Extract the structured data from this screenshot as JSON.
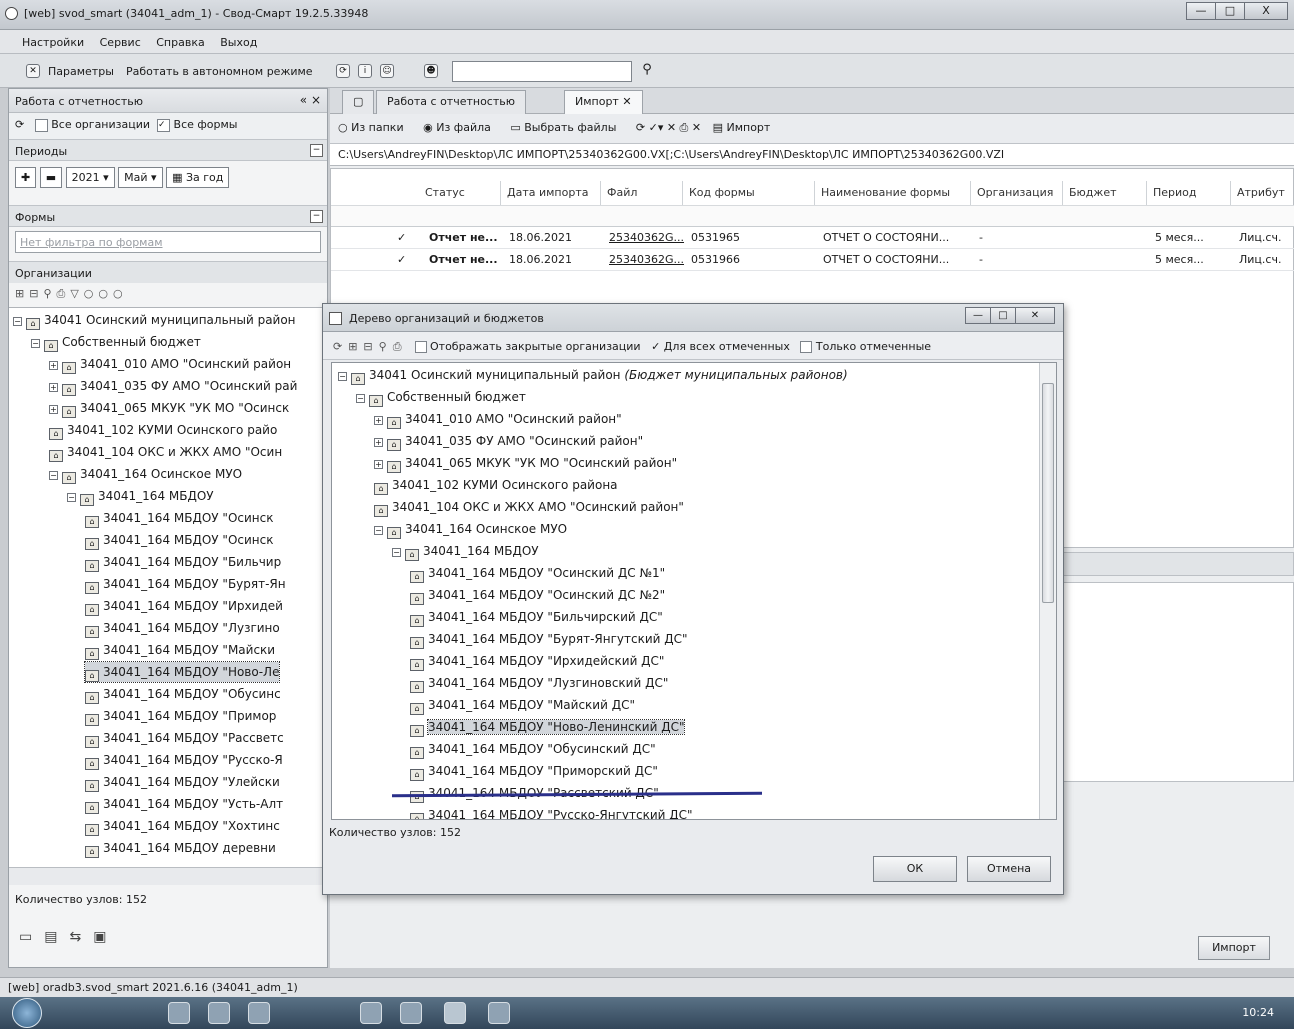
{
  "window": {
    "title": "[web] svod_smart (34041_adm_1) - Свод-Смарт 19.2.5.33948",
    "minimize": "—",
    "maximize": "□",
    "close": "X"
  },
  "menu": [
    "Настройки",
    "Сервис",
    "Справка",
    "Выход"
  ],
  "toolbar": {
    "params_label": "Параметры",
    "offline_label": "Работать в автономном режиме",
    "search_value": ""
  },
  "left": {
    "title": "Работа с отчетностью",
    "close": "« ×",
    "all_orgs": "Все организации",
    "all_forms": "Все формы",
    "periods": "Периоды",
    "year": "2021",
    "month": "Май",
    "for_year": "За год",
    "forms": "Формы",
    "forms_filter": "Нет фильтра по формам",
    "orgs": "Организации",
    "tree": [
      "34041 Осинский муниципальный район",
      "Собственный бюджет",
      "34041_010 АМО \"Осинский район",
      "34041_035 ФУ АМО \"Осинский рай",
      "34041_065 МКУК \"УК МО \"Осинск",
      "34041_102 КУМИ Осинского райо",
      "34041_104 ОКС и ЖКХ АМО \"Осин",
      "34041_164 Осинское МУО",
      "34041_164 МБДОУ",
      "34041_164 МБДОУ \"Осинск",
      "34041_164 МБДОУ \"Осинск",
      "34041_164 МБДОУ \"Бильчир",
      "34041_164 МБДОУ \"Бурят-Ян",
      "34041_164 МБДОУ \"Ирхидей",
      "34041_164 МБДОУ \"Лузгино",
      "34041_164 МБДОУ \"Майски",
      "34041_164 МБДОУ \"Ново-Ле",
      "34041_164 МБДОУ \"Обусинс",
      "34041_164 МБДОУ \"Примор",
      "34041_164 МБДОУ \"Рассветс",
      "34041_164 МБДОУ \"Русско-Я",
      "34041_164 МБДОУ \"Улейски",
      "34041_164 МБДОУ \"Усть-Алт",
      "34041_164 МБДОУ \"Хохтинс",
      "34041_164 МБДОУ деревни"
    ],
    "count": "Количество узлов: 152"
  },
  "tabs": [
    "Работа с отчетностью",
    "Импорт"
  ],
  "subtoolbar": {
    "from_folder": "Из папки",
    "from_file": "Из файла",
    "choose_files": "Выбрать файлы",
    "import": "Импорт"
  },
  "path": "C:\\Users\\AndreyFIN\\Desktop\\ЛС  ИМПОРТ\\25340362G00.VX[;C:\\Users\\AndreyFIN\\Desktop\\ЛС  ИМПОРТ\\25340362G00.VZI",
  "grid": {
    "headers": [
      "Статус",
      "Дата импорта",
      "Файл",
      "Код формы",
      "Наименование формы",
      "Организация",
      "Бюджет",
      "Период",
      "Атрибут"
    ],
    "rows": [
      [
        "✓",
        "Отчет не...",
        "18.06.2021",
        "25340362G...",
        "0531965",
        "ОТЧЕТ О СОСТОЯНИ...",
        "-",
        "",
        "5 меся...",
        "Лиц.сч."
      ],
      [
        "✓",
        "Отчет не...",
        "18.06.2021",
        "25340362G...",
        "0531966",
        "ОТЧЕТ О СОСТОЯНИ...",
        "-",
        "",
        "5 меся...",
        "Лиц.сч."
      ]
    ]
  },
  "import_button": "Импорт",
  "status": "[web] oradb3.svod_smart 2021.6.16 (34041_adm_1)",
  "clock": "10:24",
  "dialog": {
    "title": "Дерево организаций и бюджетов",
    "show_closed": "Отображать закрытые организации",
    "for_all_checked": "Для всех отмеченных",
    "only_checked": "Только отмеченные",
    "root": "34041 Осинский муниципальный район",
    "root_note": "(Бюджет муниципальных районов)",
    "tree": [
      "Собственный бюджет",
      "34041_010 АМО \"Осинский район\"",
      "34041_035 ФУ АМО \"Осинский район\"",
      "34041_065 МКУК \"УК МО \"Осинский район\"",
      "34041_102 КУМИ Осинского района",
      "34041_104 ОКС и ЖКХ АМО \"Осинский район\"",
      "34041_164 Осинское МУО",
      "34041_164 МБДОУ",
      "34041_164 МБДОУ \"Осинский ДС №1\"",
      "34041_164 МБДОУ \"Осинский ДС №2\"",
      "34041_164 МБДОУ \"Бильчирский ДС\"",
      "34041_164 МБДОУ \"Бурят-Янгутский ДС\"",
      "34041_164 МБДОУ \"Ирхидейский ДС\"",
      "34041_164 МБДОУ \"Лузгиновский ДС\"",
      "34041_164 МБДОУ \"Майский ДС\"",
      "34041_164 МБДОУ \"Ново-Ленинский ДС\"",
      "34041_164 МБДОУ \"Обусинский ДС\"",
      "34041_164 МБДОУ \"Приморский ДС\"",
      "34041_164 МБДОУ \"Рассветский ДС\"",
      "34041_164 МБДОУ \"Русско-Янгутский ДС\""
    ],
    "count": "Количество узлов: 152",
    "ok": "ОК",
    "cancel": "Отмена"
  }
}
